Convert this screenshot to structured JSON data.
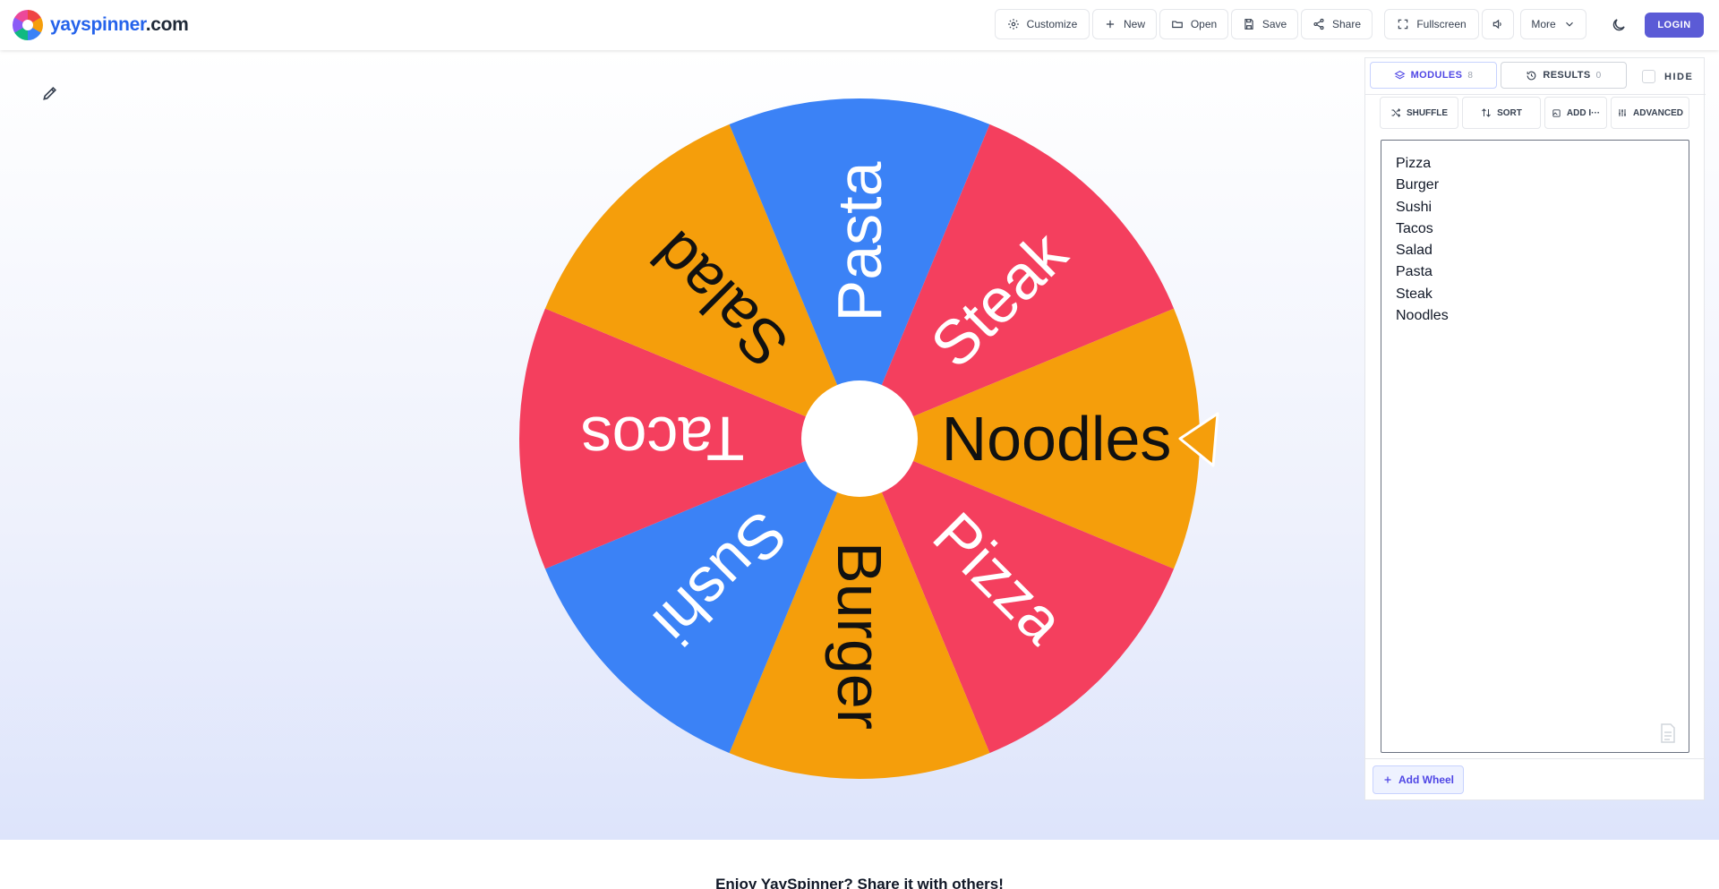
{
  "brand": {
    "name_part1": "yayspinner",
    "name_part2": ".com"
  },
  "toolbar": {
    "customize": "Customize",
    "new": "New",
    "open": "Open",
    "save": "Save",
    "share": "Share",
    "fullscreen": "Fullscreen",
    "more": "More",
    "login": "LOGIN"
  },
  "wheel": {
    "pointer_on": "Noodles",
    "segments": [
      {
        "label": "Noodles",
        "color": "#f59e0b",
        "text_color": "#111111"
      },
      {
        "label": "Pizza",
        "color": "#f43f5e",
        "text_color": "#ffffff"
      },
      {
        "label": "Burger",
        "color": "#f59e0b",
        "text_color": "#111111"
      },
      {
        "label": "Sushi",
        "color": "#3b82f6",
        "text_color": "#ffffff"
      },
      {
        "label": "Tacos",
        "color": "#f43f5e",
        "text_color": "#ffffff"
      },
      {
        "label": "Salad",
        "color": "#f59e0b",
        "text_color": "#111111"
      },
      {
        "label": "Pasta",
        "color": "#3b82f6",
        "text_color": "#ffffff"
      },
      {
        "label": "Steak",
        "color": "#f43f5e",
        "text_color": "#ffffff"
      }
    ],
    "hub_color": "#ffffff",
    "pointer_color": "#f59e0b"
  },
  "panel": {
    "tabs": {
      "modules_label": "MODULES",
      "modules_count": "8",
      "results_label": "RESULTS",
      "results_count": "0",
      "hide_label": "HIDE"
    },
    "tools": {
      "shuffle": "SHUFFLE",
      "sort": "SORT",
      "add_image": "ADD I···",
      "advanced": "ADVANCED"
    },
    "entries": [
      "Pizza",
      "Burger",
      "Sushi",
      "Tacos",
      "Salad",
      "Pasta",
      "Steak",
      "Noodles"
    ],
    "add_wheel": "Add Wheel"
  },
  "footer": {
    "share_note": "Enjoy YaySpinner? Share it with others!"
  },
  "colors": {
    "accent": "#5b5bd6",
    "orange": "#f59e0b",
    "red": "#f43f5e",
    "blue": "#3b82f6"
  }
}
